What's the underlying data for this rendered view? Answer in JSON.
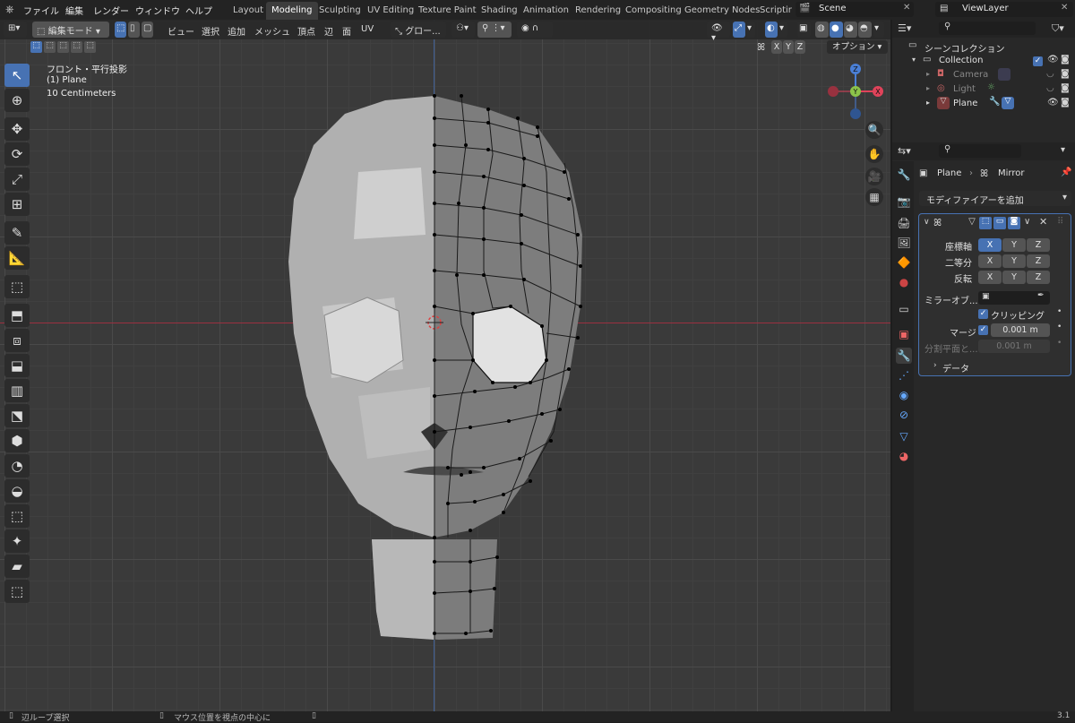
{
  "menubar": {
    "items": [
      "ファイル",
      "編集",
      "レンダー",
      "ウィンドウ",
      "ヘルプ"
    ],
    "workspaces": [
      "Layout",
      "Modeling",
      "Sculpting",
      "UV Editing",
      "Texture Paint",
      "Shading",
      "Animation",
      "Rendering",
      "Compositing",
      "Geometry Nodes",
      "Scriptir"
    ],
    "active_workspace": "Modeling",
    "scene": "Scene",
    "view_layer": "ViewLayer"
  },
  "viewport_header": {
    "mode": "編集モード",
    "menus": [
      "ビュー",
      "選択",
      "追加",
      "メッシュ",
      "頂点",
      "辺",
      "面",
      "UV"
    ],
    "transform_orientation": "グロー...",
    "options": "オプション",
    "axes": [
      "X",
      "Y",
      "Z"
    ]
  },
  "viewport_info": {
    "view": "フロント・平行投影",
    "object": "(1) Plane",
    "scale": "10 Centimeters"
  },
  "gizmo": {
    "axes": [
      "Z",
      "Y",
      "X"
    ]
  },
  "outliner": {
    "title": "シーンコレクション",
    "collection": "Collection",
    "items": [
      "Camera",
      "Light",
      "Plane"
    ]
  },
  "properties": {
    "breadcrumb_object": "Plane",
    "breadcrumb_modifier": "Mirror",
    "add_modifier": "モディファイアーを追加",
    "axis_label": "座標軸",
    "bisect_label": "二等分",
    "flip_label": "反転",
    "axes": [
      "X",
      "Y",
      "Z"
    ],
    "mirror_object_label": "ミラーオブ...",
    "clipping_label": "クリッピング",
    "merge_label": "マージ",
    "merge_value": "0.001 m",
    "bisect_distance_label": "分割平面と...",
    "bisect_distance_value": "0.001 m",
    "data_label": "データ"
  },
  "statusbar": {
    "left": "辺ループ選択",
    "middle": "マウス位置を視点の中心に",
    "version": "3.1"
  },
  "colors": {
    "accent": "#4772b3",
    "x_axis": "#e0435a",
    "y_axis": "#8bc34a",
    "z_axis": "#4a7fd6"
  }
}
